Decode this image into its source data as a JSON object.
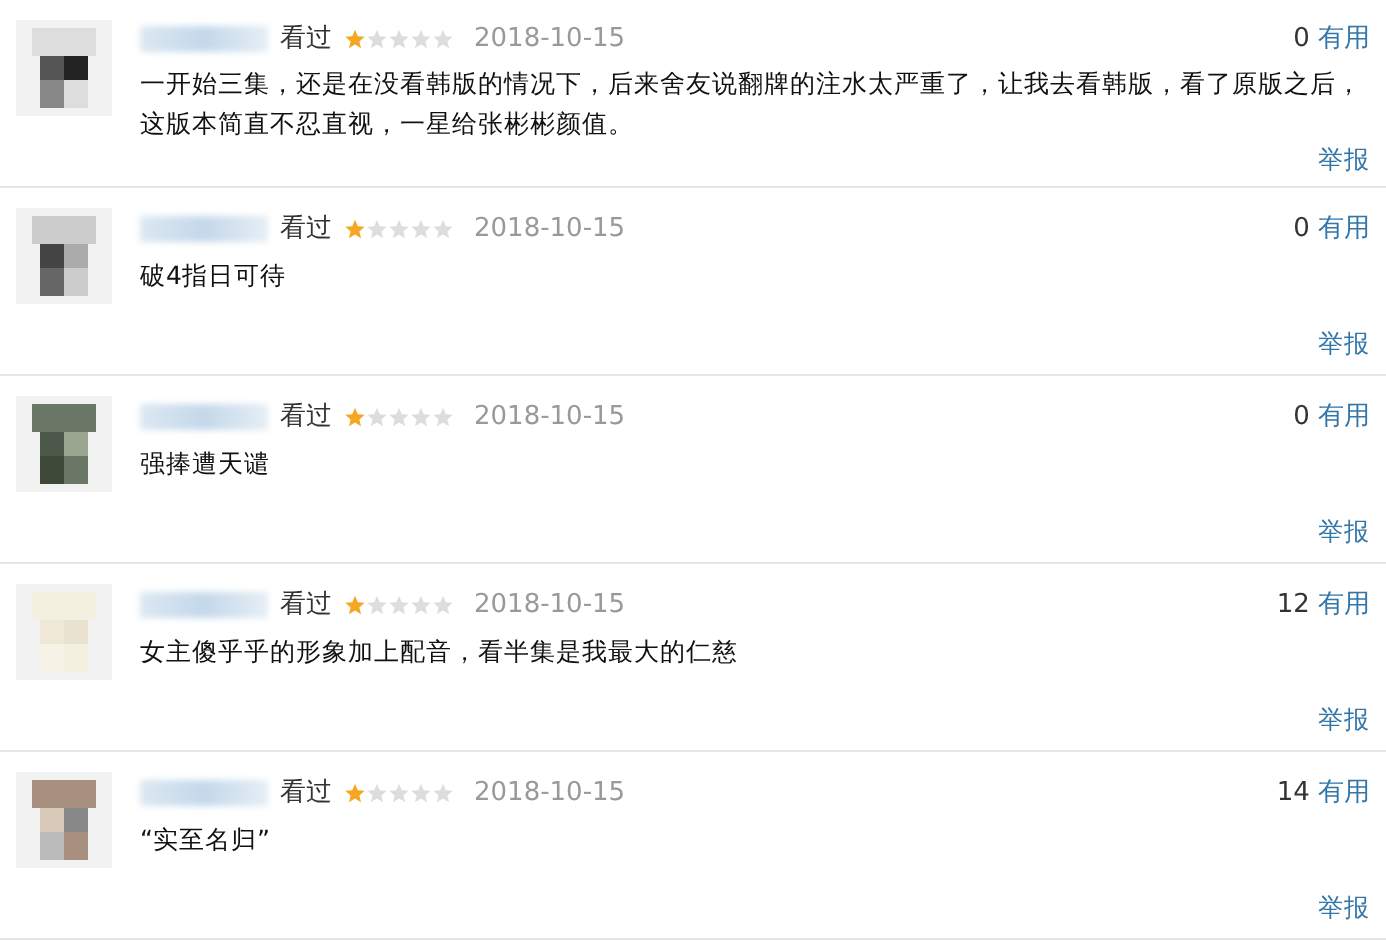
{
  "comments": [
    {
      "status": "看过",
      "stars": 1,
      "date": "2018-10-15",
      "votes": "0",
      "vote_label": "有用",
      "text": "一开始三集，还是在没看韩版的情况下，后来舍友说翻牌的注水太严重了，让我去看韩版，看了原版之后，这版本简直不忍直视，一星给张彬彬颜值。",
      "report": "举报"
    },
    {
      "status": "看过",
      "stars": 1,
      "date": "2018-10-15",
      "votes": "0",
      "vote_label": "有用",
      "text": "破4指日可待",
      "report": "举报"
    },
    {
      "status": "看过",
      "stars": 1,
      "date": "2018-10-15",
      "votes": "0",
      "vote_label": "有用",
      "text": "强捧遭天谴",
      "report": "举报"
    },
    {
      "status": "看过",
      "stars": 1,
      "date": "2018-10-15",
      "votes": "12",
      "vote_label": "有用",
      "text": "女主傻乎乎的形象加上配音，看半集是我最大的仁慈",
      "report": "举报"
    },
    {
      "status": "看过",
      "stars": 1,
      "date": "2018-10-15",
      "votes": "14",
      "vote_label": "有用",
      "text": "“实至名归”",
      "report": "举报"
    }
  ]
}
